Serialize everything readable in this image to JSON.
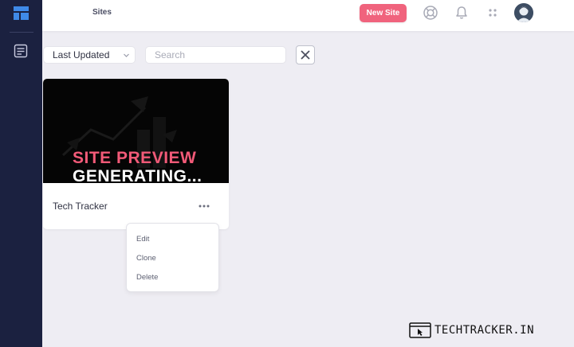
{
  "topbar": {
    "title": "Sites",
    "new_site_label": "New Site"
  },
  "toolbar": {
    "sort_value": "Last Updated",
    "search_placeholder": "Search"
  },
  "site_card": {
    "preview_line1": "SITE PREVIEW",
    "preview_line2": "GENERATING...",
    "name": "Tech Tracker"
  },
  "context_menu": {
    "items": [
      "Edit",
      "Clone",
      "Delete"
    ]
  },
  "watermark": {
    "text": "TECHTRACKER.IN"
  },
  "icons": {
    "logo": "dashboard-logo-icon",
    "nav": "page-icon",
    "help": "lifebuoy-icon",
    "notifications": "bell-icon",
    "apps": "apps-grid-icon",
    "sort_chevron": "chevron-down-icon",
    "clear": "close-icon",
    "more": "ellipsis-icon"
  },
  "colors": {
    "sidebar": "#1b2140",
    "accent": "#f0637d",
    "logo": "#3f8ae8",
    "preview_highlight": "#f25a78",
    "background": "#eeedf3"
  }
}
